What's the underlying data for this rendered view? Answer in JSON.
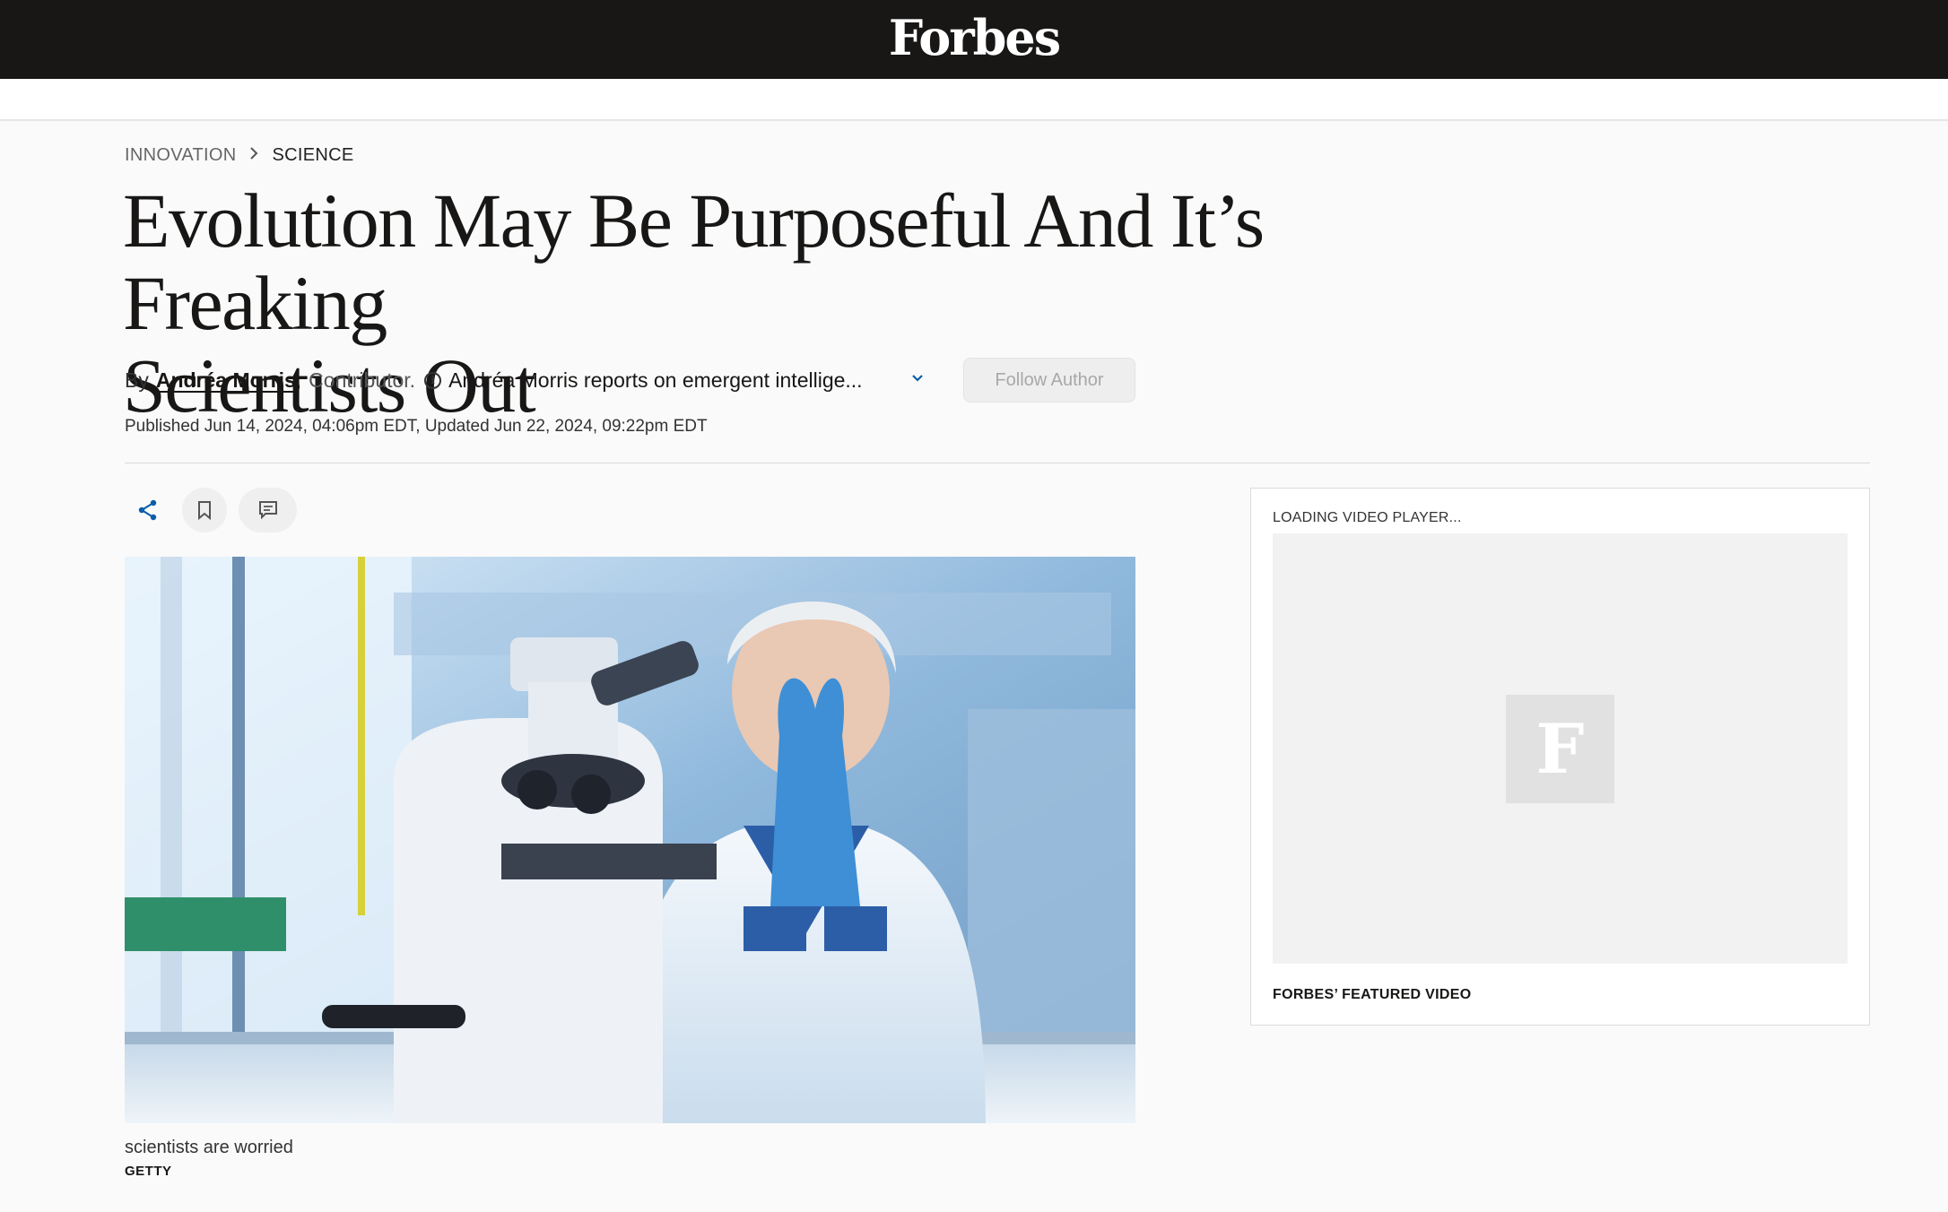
{
  "header": {
    "logo_text": "Forbes"
  },
  "breadcrumb": {
    "section": "INNOVATION",
    "subsection": "SCIENCE"
  },
  "article": {
    "headline_line1": "Evolution May Be Purposeful And It’s Freaking",
    "headline_line2": "Scientists Out",
    "by_word": "By",
    "author": "Andréa Morris",
    "comma": ",",
    "role": "Contributor.",
    "info_icon_glyph": "i",
    "bio": "Andréa Morris reports on emergent intellige...",
    "follow_label": "Follow Author",
    "published": "Published Jun 14, 2024, 04:06pm EDT, Updated Jun 22, 2024, 09:22pm EDT"
  },
  "actions": {
    "share_icon": "share-icon",
    "save_icon": "bookmark-icon",
    "comment_icon": "comment-icon",
    "accent_color": "#0a5eaa"
  },
  "image": {
    "caption": "scientists are worried",
    "credit": "GETTY"
  },
  "video": {
    "loading_text": "LOADING VIDEO PLAYER...",
    "logo_glyph": "F",
    "title": "FORBES’ FEATURED VIDEO"
  }
}
